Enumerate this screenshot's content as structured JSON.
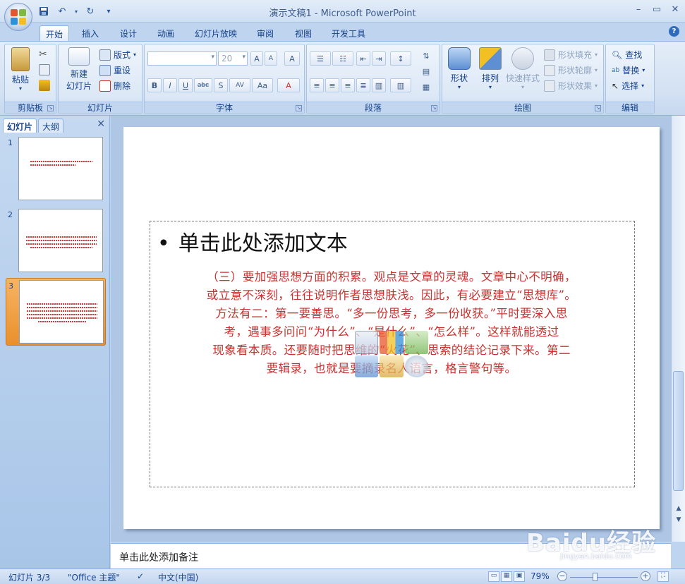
{
  "window": {
    "title": "演示文稿1 - Microsoft PowerPoint",
    "minimize_icon": "minimize-icon",
    "maximize_icon": "maximize-icon",
    "close_icon": "close-icon"
  },
  "qat": {
    "save_icon": "save-icon",
    "undo_icon": "undo-icon",
    "redo_icon": "redo-icon",
    "more_icon": "customize-qat-icon"
  },
  "tabs": [
    "开始",
    "插入",
    "设计",
    "动画",
    "幻灯片放映",
    "审阅",
    "视图",
    "开发工具"
  ],
  "ribbon": {
    "clipboard": {
      "label": "剪贴板",
      "paste": "粘贴"
    },
    "slides": {
      "label": "幻灯片",
      "new_slide": "新建",
      "new_slide2": "幻灯片",
      "layout": "版式",
      "reset": "重设",
      "delete": "删除"
    },
    "font": {
      "label": "字体",
      "size": "20",
      "bold": "B",
      "italic": "I",
      "underline": "U",
      "strike": "abc",
      "shadow": "S",
      "spacing": "AV",
      "case": "Aa",
      "grow": "A",
      "shrink": "A",
      "clear": "A",
      "color": "A"
    },
    "paragraph": {
      "label": "段落"
    },
    "drawing": {
      "label": "绘图",
      "shapes": "形状",
      "arrange": "排列",
      "quick_styles": "快速样式",
      "fill": "形状填充",
      "outline": "形状轮廓",
      "effects": "形状效果"
    },
    "editing": {
      "label": "编辑",
      "find": "查找",
      "replace": "替换",
      "select": "选择"
    }
  },
  "pane": {
    "tab_slides": "幻灯片",
    "tab_outline": "大纲",
    "slides": [
      {
        "num": "1",
        "selected": false
      },
      {
        "num": "2",
        "selected": false
      },
      {
        "num": "3",
        "selected": true
      }
    ]
  },
  "slide": {
    "bullet_text": "单击此处添加文本",
    "body_lines": [
      "（三）要加强思想方面的积累。观点是文章的灵魂。文章中心不明确，",
      "或立意不深刻，往往说明作者思想肤浅。因此，有必要建立“思想库”。",
      "方法有二：第一要善思。“多一份思考，多一份收获。”平时要深入思",
      "考，遇事多问问“为什么”、“是什么”、“怎么样”。这样就能透过",
      "现象看本质。还要随时把思维的“火花”、思索的结论记录下来。第二",
      "要辑录，也就是要摘录名人语言，格言警句等。"
    ]
  },
  "notes": {
    "placeholder": "单击此处添加备注"
  },
  "watermark": {
    "brand": "Baidu经验",
    "url": "jingyan.baidu.com"
  },
  "status": {
    "slide_count": "幻灯片 3/3",
    "theme": "\"Office 主题\"",
    "language": "中文(中国)",
    "zoom": "79%"
  },
  "colors": {
    "accent": "#15428b",
    "body_text": "#c8322f",
    "selected_thumb": "#e9902c"
  }
}
